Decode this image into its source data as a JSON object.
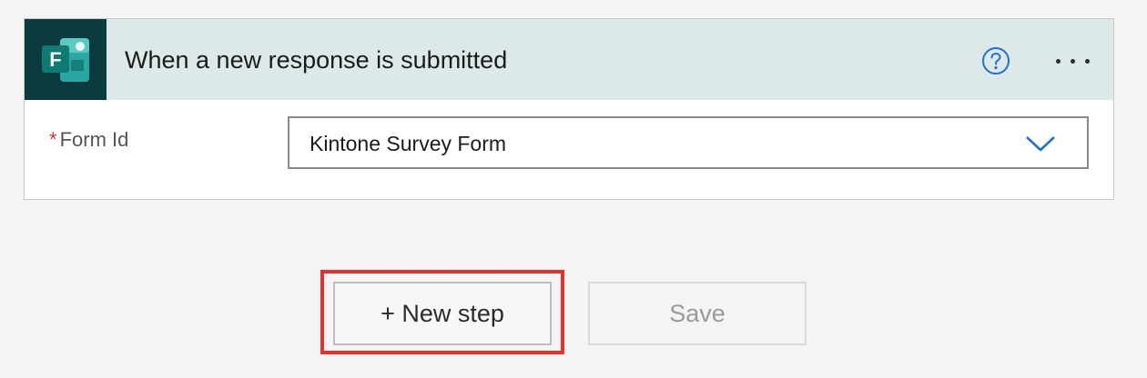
{
  "trigger": {
    "title": "When a new response is submitted",
    "app_icon_letter": "F",
    "app_icon": "microsoft-forms-icon",
    "help_icon": "question-circle-icon",
    "more_icon": "ellipsis-icon"
  },
  "form_field": {
    "required_marker": "*",
    "label": "Form Id",
    "value": "Kintone Survey Form",
    "chevron_icon": "chevron-down-icon"
  },
  "actions": {
    "new_step_label": "+ New step",
    "save_label": "Save"
  },
  "colors": {
    "header_bg": "#dde9e8",
    "app_tile_bg": "#0b3b3f",
    "accent_blue": "#1f6fd6",
    "required_red": "#d13438",
    "highlight_red": "#e4322b"
  }
}
